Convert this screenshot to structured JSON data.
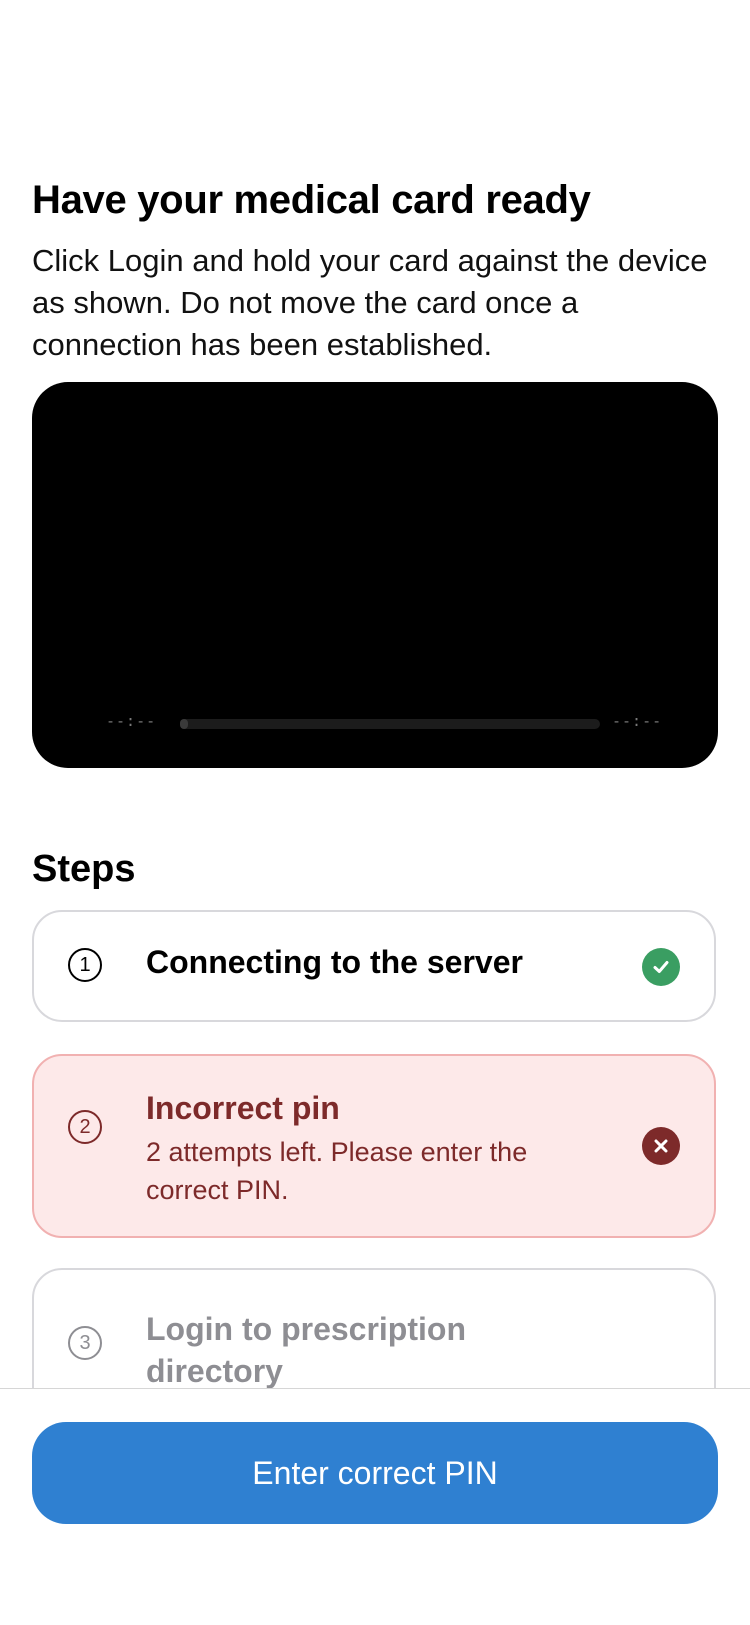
{
  "header": {
    "title": "Have your medical card ready",
    "description": "Click Login and hold your card against the device as shown. Do not move the card once a connection has been established."
  },
  "video": {
    "elapsed": "--:--",
    "remaining": "--:--",
    "progress": 0.02
  },
  "steps": {
    "title": "Steps",
    "items": [
      {
        "number": "1",
        "label": "Connecting to the server",
        "status": "success",
        "status_icon": "checkmark-icon"
      },
      {
        "number": "2",
        "label": "Incorrect pin",
        "detail": "2 attempts left. Please enter the correct PIN.",
        "status": "error",
        "status_icon": "close-icon"
      },
      {
        "number": "3",
        "label": "Login to prescription directory",
        "status": "pending"
      }
    ]
  },
  "footer": {
    "button_label": "Enter correct PIN"
  },
  "colors": {
    "accent": "#2f80d1",
    "success": "#3a9e62",
    "error": "#7d2a2a",
    "error_bg": "#fde9e9",
    "muted": "#8e8e93"
  }
}
